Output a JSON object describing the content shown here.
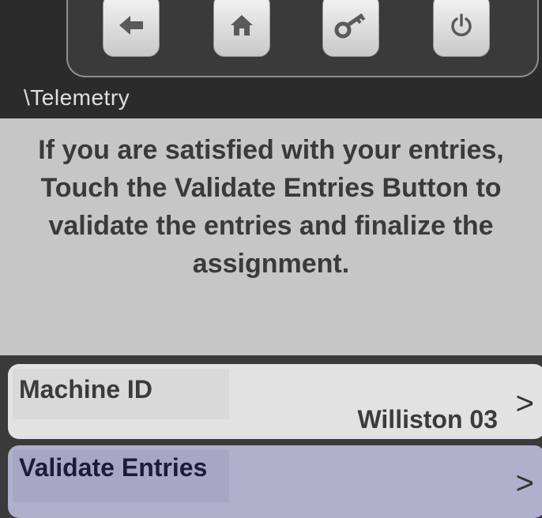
{
  "toolbar": {
    "buttons": [
      {
        "icon": "back-arrow-icon"
      },
      {
        "icon": "home-icon"
      },
      {
        "icon": "key-icon"
      },
      {
        "icon": "power-icon"
      }
    ]
  },
  "breadcrumb": "\\Telemetry",
  "message": "If you are satisfied with your entries, Touch the Validate Entries Button to validate the entries and finalize the assignment.",
  "rows": [
    {
      "label": "Machine ID",
      "value": "Williston 03",
      "chevron": ">"
    },
    {
      "label": "Validate Entries",
      "value": "",
      "chevron": ">"
    }
  ],
  "colors": {
    "background": "#2b2b2b",
    "message_panel": "#c6c6c6",
    "row_default": "#e2e2e2",
    "row_highlight": "#b0b0cc"
  }
}
